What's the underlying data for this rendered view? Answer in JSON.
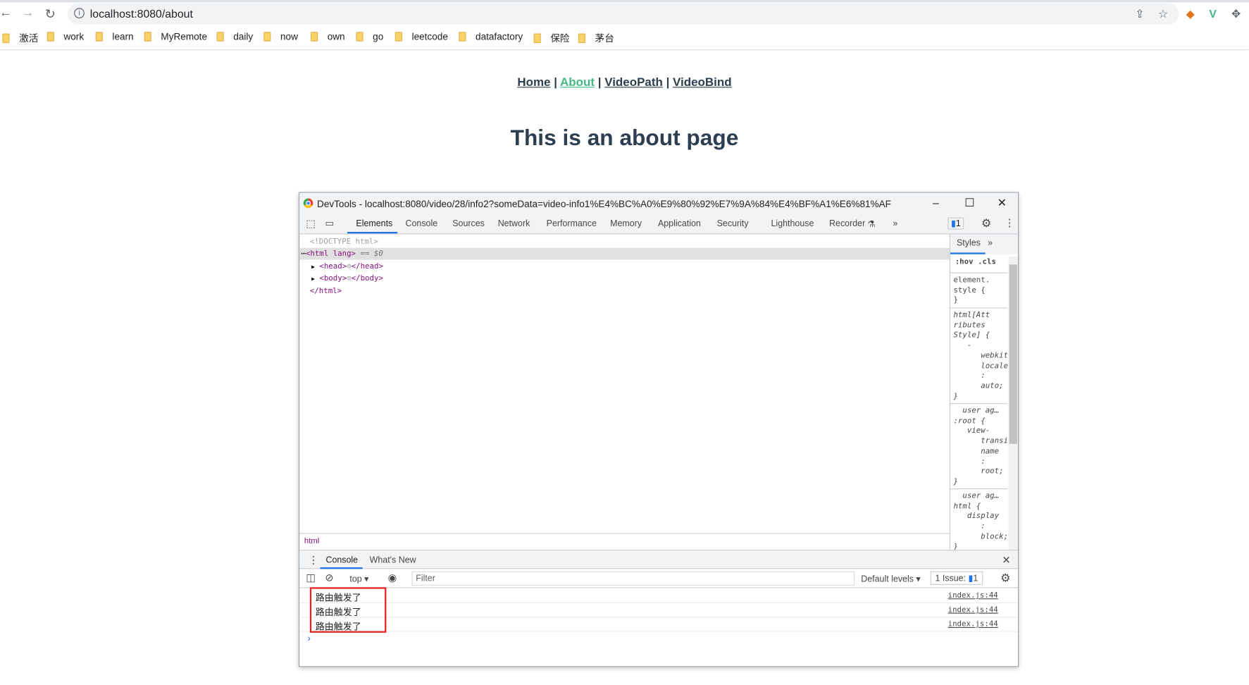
{
  "browser": {
    "url": "localhost:8080/about",
    "bookmarks": [
      "激活",
      "work",
      "learn",
      "MyRemote",
      "daily",
      "now",
      "own",
      "go",
      "leetcode",
      "datafactory",
      "保险",
      "茅台"
    ]
  },
  "page": {
    "nav": [
      "Home",
      "About",
      "VideoPath",
      "VideoBind"
    ],
    "nav_separator": "|",
    "heading": "This is an about page",
    "accent": "#42b983"
  },
  "devtools": {
    "title": "DevTools - localhost:8080/video/28/info2?someData=video-info1%E4%BC%A0%E9%80%92%E7%9A%84%E4%BF%A1%E6%81%AF",
    "tabs": [
      "Elements",
      "Console",
      "Sources",
      "Network",
      "Performance",
      "Memory",
      "Application",
      "Security",
      "Lighthouse",
      "Recorder"
    ],
    "issue_badge": "1",
    "dom": [
      "<!DOCTYPE html>",
      "<html lang>",
      "== $0",
      "<head>",
      "</head>",
      "<body>",
      "</body>",
      "</html>"
    ],
    "styles_tab": "Styles",
    "hov": ":hov",
    "cls": ".cls",
    "style_blocks": [
      "element.\nstyle {\n}",
      "html[Att\nributes\nStyle] {\n   -\n      webkit\n      locale\n      :\n      auto;\n}",
      "  user ag…\n:root {\n   view-\n      transi\n      name\n      :\n      root;\n}",
      "  user ag…\nhtml {\n   display\n      :\n      block;\n}"
    ],
    "breadcrumb": "html",
    "drawer_tabs": [
      "Console",
      "What's New"
    ],
    "console": {
      "context": "top",
      "filter_placeholder": "Filter",
      "levels": "Default levels",
      "issues": "1 Issue:",
      "issues_count": "1",
      "messages": [
        {
          "text": "路由触发了",
          "source": "index.js:44"
        },
        {
          "text": "路由触发了",
          "source": "index.js:44"
        },
        {
          "text": "路由触发了",
          "source": "index.js:44"
        }
      ],
      "prompt": "›"
    }
  }
}
